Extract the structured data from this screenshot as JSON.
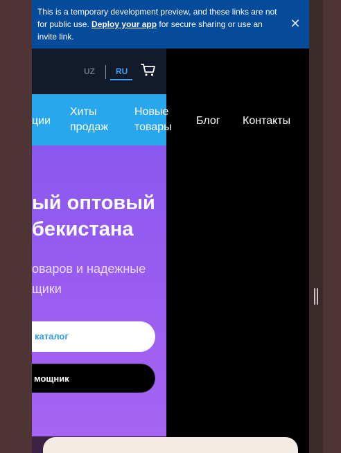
{
  "banner": {
    "text_before": "This is a temporary development preview, and these links are not for public use. ",
    "link": "Deploy your app",
    "text_after": " for secure sharing or use an invite link.",
    "close_icon": "close-icon"
  },
  "header": {
    "lang_uz": "UZ",
    "lang_ru": "RU",
    "cart_icon": "cart-icon",
    "accent": "#3ea2f0"
  },
  "nav": {
    "items": [
      {
        "line1": "ции",
        "line2": ""
      },
      {
        "line1": "Хиты",
        "line2": "продаж"
      },
      {
        "line1": "Новые",
        "line2": "товары"
      },
      {
        "line1": "Блог",
        "line2": ""
      },
      {
        "line1": "Контакты",
        "line2": ""
      }
    ],
    "color": "#28a7ef"
  },
  "hero": {
    "title_line1": "ый оптовый",
    "title_line2": "бекистана",
    "subtitle_line1": "оваров и надежные",
    "subtitle_line2": "щики",
    "catalog_button": "каталог",
    "helper_button": "мощник",
    "gradient_top": "#8b57ee",
    "gradient_bottom": "#a764f2"
  }
}
